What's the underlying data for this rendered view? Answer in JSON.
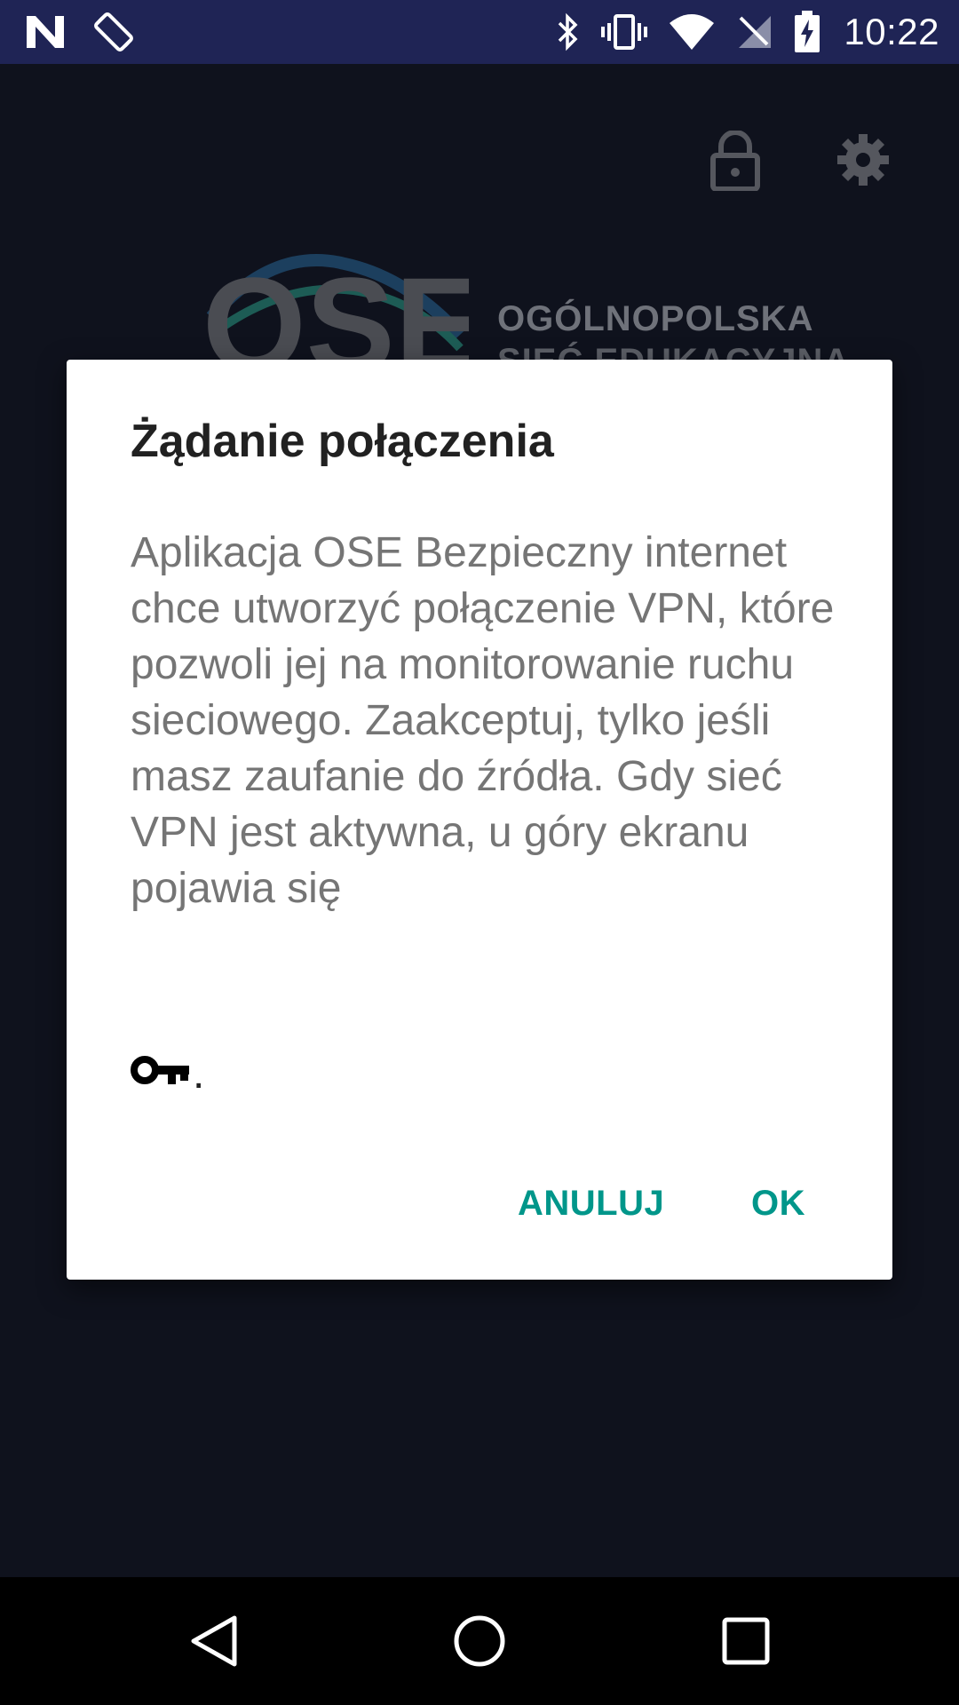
{
  "status_bar": {
    "time": "10:22",
    "icons": [
      "n-logo-icon",
      "screen-rotation-icon",
      "bluetooth-icon",
      "vibrate-icon",
      "wifi-icon",
      "no-signal-icon",
      "battery-charging-icon"
    ]
  },
  "app": {
    "toolbar_icons": [
      "lock-icon",
      "gear-icon"
    ],
    "logo_text": "OSE",
    "logo_caption_line1": "OGÓLNOPOLSKA",
    "logo_caption_line2": "SIEĆ EDUKACYJNA"
  },
  "dialog": {
    "title": "Żądanie połączenia",
    "message": "Aplikacja OSE Bezpieczny internet chce utworzyć połączenie VPN, które pozwoli jej na monitorowanie ruchu sieciowego. Zaakceptuj, tylko jeśli masz zaufanie do źródła. Gdy sieć VPN jest aktywna, u góry ekranu pojawia się",
    "key_icon": "vpn-key-icon",
    "suffix": ".",
    "cancel_label": "ANULUJ",
    "ok_label": "OK"
  },
  "nav_bar": {
    "buttons": [
      "back-icon",
      "home-icon",
      "recents-icon"
    ]
  },
  "colors": {
    "status_bar": "#1f2455",
    "background": "#0f121d",
    "dialog_bg": "#ffffff",
    "accent": "#00968a",
    "title_text": "#212121",
    "body_text": "#757575"
  }
}
